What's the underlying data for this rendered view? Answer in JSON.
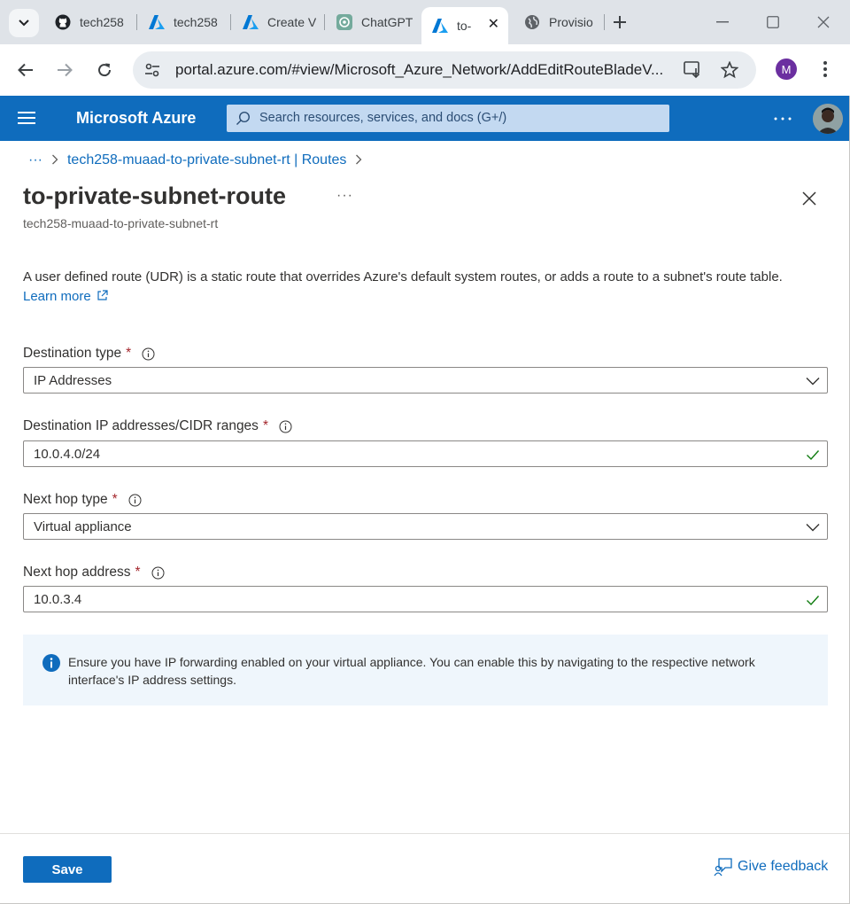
{
  "browser": {
    "tabs": [
      {
        "label": "tech258",
        "icon": "github-icon"
      },
      {
        "label": "tech258",
        "icon": "azure-icon"
      },
      {
        "label": "Create V",
        "icon": "azure-icon"
      },
      {
        "label": "ChatGPT",
        "icon": "chatgpt-icon"
      },
      {
        "label": "to-",
        "icon": "azure-icon",
        "active": true
      },
      {
        "label": "Provisio",
        "icon": "globe-icon"
      }
    ],
    "url": "portal.azure.com/#view/Microsoft_Azure_Network/AddEditRouteBladeV...",
    "profile_initial": "M"
  },
  "azure_header": {
    "brand": "Microsoft Azure",
    "search_placeholder": "Search resources, services, and docs (G+/)"
  },
  "breadcrumb": {
    "ellipsis": "···",
    "parent": "tech258-muaad-to-private-subnet-rt | Routes"
  },
  "page": {
    "title": "to-private-subnet-route",
    "more": "···",
    "subtitle": "tech258-muaad-to-private-subnet-rt",
    "description": "A user defined route (UDR) is a static route that overrides Azure's default system routes, or adds a route to a subnet's route table.",
    "learn_more": "Learn more"
  },
  "form": {
    "destination_type": {
      "label": "Destination type",
      "required": "*",
      "value": "IP Addresses"
    },
    "destination_ips": {
      "label": "Destination IP addresses/CIDR ranges",
      "required": "*",
      "value": "10.0.4.0/24"
    },
    "next_hop_type": {
      "label": "Next hop type",
      "required": "*",
      "value": "Virtual appliance"
    },
    "next_hop_address": {
      "label": "Next hop address",
      "required": "*",
      "value": "10.0.3.4"
    }
  },
  "info_message": "Ensure you have IP forwarding enabled on your virtual appliance. You can enable this by navigating to the respective network interface's IP address settings.",
  "footer": {
    "save_label": "Save",
    "feedback_label": "Give feedback"
  },
  "colors": {
    "azure_blue": "#0f6cbd",
    "required_red": "#a4262c",
    "valid_green": "#107c10",
    "info_bg": "#eff6fc"
  }
}
